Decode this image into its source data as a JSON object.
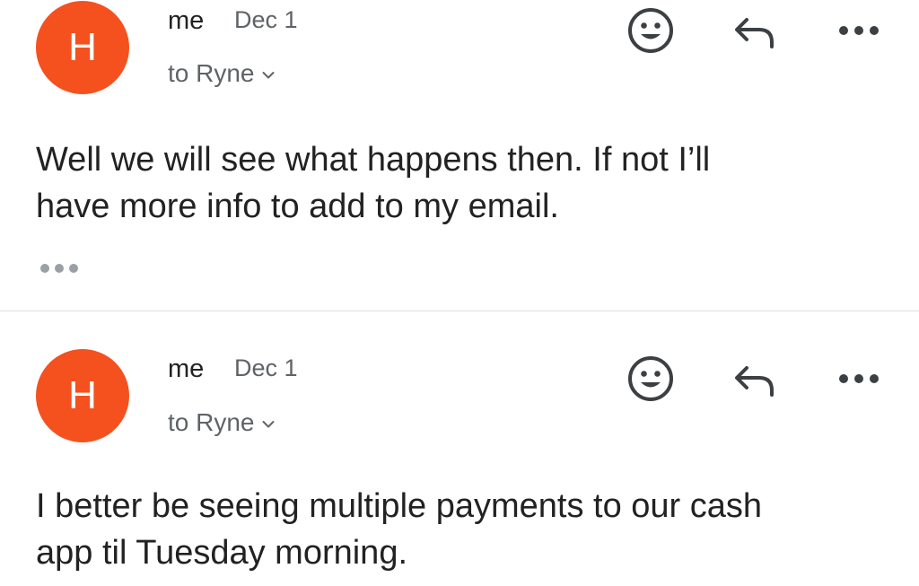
{
  "messages": [
    {
      "avatar_letter": "H",
      "sender": "me",
      "date": "Dec 1",
      "recipient": "to Ryne",
      "body_lines": [
        "Well we will see what happens then. If not I’ll",
        "have more info to add to my email."
      ],
      "icons": [
        "emoji-reaction-icon",
        "reply-icon",
        "more-options-icon",
        "show-trimmed-content-icon"
      ]
    },
    {
      "avatar_letter": "H",
      "sender": "me",
      "date": "Dec 1",
      "recipient": "to Ryne",
      "body_lines": [
        "I better be seeing multiple payments to our cash",
        "app til Tuesday morning."
      ],
      "icons": [
        "emoji-reaction-icon",
        "reply-icon",
        "more-options-icon"
      ]
    }
  ],
  "colors": {
    "avatar": "#f4511e",
    "secondary_text": "#5f6368",
    "icon": "#3c4043"
  }
}
